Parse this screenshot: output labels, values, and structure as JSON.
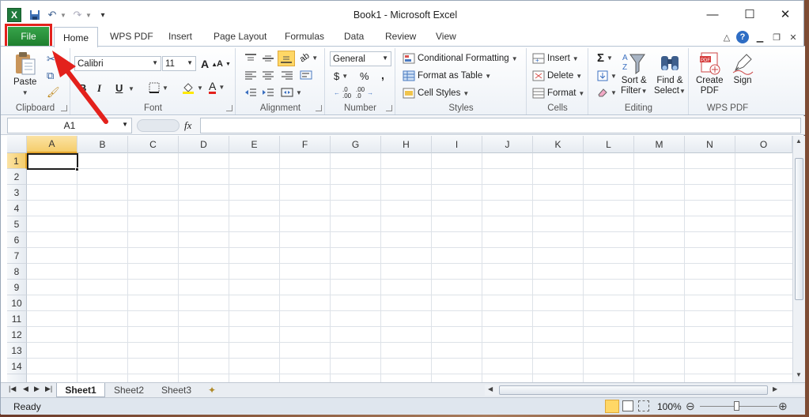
{
  "window": {
    "title": "Book1  -  Microsoft Excel",
    "app_icon": "X"
  },
  "win_controls": {
    "minimize": "—",
    "maximize": "☐",
    "close": "✕"
  },
  "tabs": {
    "file": "File",
    "home": "Home",
    "items": [
      "WPS PDF",
      "Insert",
      "Page Layout",
      "Formulas",
      "Data",
      "Review",
      "View"
    ]
  },
  "ribbon": {
    "clipboard": {
      "paste": "Paste",
      "label": "Clipboard"
    },
    "font": {
      "name": "Calibri",
      "size": "11",
      "bold": "B",
      "italic": "I",
      "underline": "U",
      "grow": "A",
      "shrink": "A",
      "color_letter": "A",
      "label": "Font"
    },
    "alignment": {
      "label": "Alignment"
    },
    "number": {
      "format": "General",
      "currency": "$",
      "percent": "%",
      "comma": ",",
      "inc": ".0\n.00",
      "dec": ".00\n.0",
      "label": "Number"
    },
    "styles": {
      "conditional": "Conditional Formatting",
      "format_table": "Format as Table",
      "cell_styles": "Cell Styles",
      "label": "Styles"
    },
    "cells": {
      "insert": "Insert",
      "delete": "Delete",
      "format": "Format",
      "label": "Cells"
    },
    "editing": {
      "sum": "Σ",
      "sort1": "Sort &",
      "sort2": "Filter",
      "find1": "Find &",
      "find2": "Select",
      "label": "Editing"
    },
    "wpspdf": {
      "create1": "Create",
      "create2": "PDF",
      "sign": "Sign",
      "label": "WPS PDF"
    }
  },
  "formula_bar": {
    "name_box": "A1",
    "fx": "fx",
    "value": ""
  },
  "columns": [
    "A",
    "B",
    "C",
    "D",
    "E",
    "F",
    "G",
    "H",
    "I",
    "J",
    "K",
    "L",
    "M",
    "N",
    "O"
  ],
  "rows": [
    "1",
    "2",
    "3",
    "4",
    "5",
    "6",
    "7",
    "8",
    "9",
    "10",
    "11",
    "12",
    "13",
    "14"
  ],
  "sheets": {
    "active": "Sheet1",
    "others": [
      "Sheet2",
      "Sheet3"
    ]
  },
  "status": {
    "ready": "Ready",
    "zoom": "100%"
  },
  "colors": {
    "file_tab": "#2a8f3c",
    "highlight": "#e3211c",
    "accent": "#1e5aa8"
  }
}
